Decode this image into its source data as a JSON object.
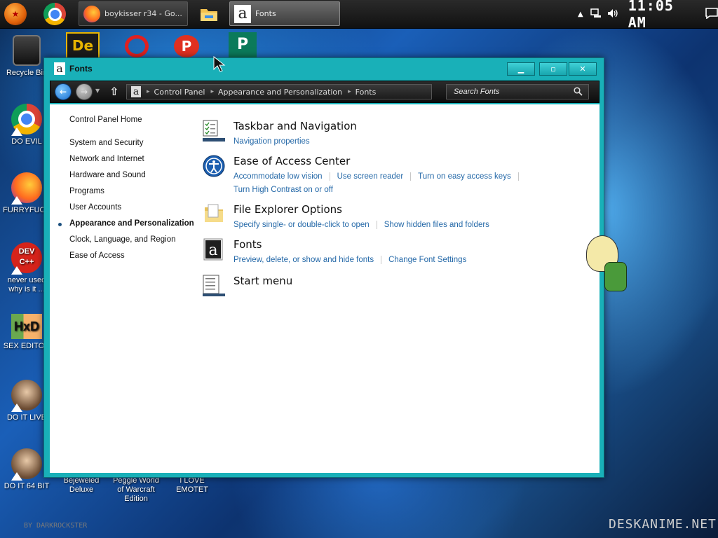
{
  "taskbar": {
    "windows": [
      {
        "title": "boykisser r34 - Go..."
      },
      {
        "title": "Fonts"
      }
    ],
    "clock": "11:05 AM"
  },
  "desktop": {
    "icons": [
      {
        "label": "Recycle Bin"
      },
      {
        "label": "DO EVIL"
      },
      {
        "label": "FURRYFUCK"
      },
      {
        "label": "never used why is it ..."
      },
      {
        "label": "SEX EDITOR"
      },
      {
        "label": "DO IT LIVE"
      },
      {
        "label": "DO IT 64 BIT"
      },
      {
        "label": "Bejeweled Deluxe"
      },
      {
        "label": "Peggle World of Warcraft Edition"
      },
      {
        "label": "I LOVE EMOTET"
      }
    ],
    "watermark_left": "BY DARKROCKSTER",
    "watermark_right": "DESKANIME.NET"
  },
  "window": {
    "title": "Fonts",
    "breadcrumb": [
      "Control Panel",
      "Appearance and Personalization",
      "Fonts"
    ],
    "search_placeholder": "Search Fonts",
    "sidebar": {
      "home": "Control Panel Home",
      "items": [
        "System and Security",
        "Network and Internet",
        "Hardware and Sound",
        "Programs",
        "User Accounts",
        "Appearance and Personalization",
        "Clock, Language, and Region",
        "Ease of Access"
      ]
    },
    "categories": [
      {
        "title": "Taskbar and Navigation",
        "links": [
          "Navigation properties"
        ]
      },
      {
        "title": "Ease of Access Center",
        "links": [
          "Accommodate low vision",
          "Use screen reader",
          "Turn on easy access keys",
          "Turn High Contrast on or off"
        ]
      },
      {
        "title": "File Explorer Options",
        "links": [
          "Specify single- or double-click to open",
          "Show hidden files and folders"
        ]
      },
      {
        "title": "Fonts",
        "links": [
          "Preview, delete, or show and hide fonts",
          "Change Font Settings"
        ]
      },
      {
        "title": "Start menu",
        "links": []
      }
    ]
  },
  "colors": {
    "window_frame": "#19b0b8",
    "link": "#2569a8"
  }
}
